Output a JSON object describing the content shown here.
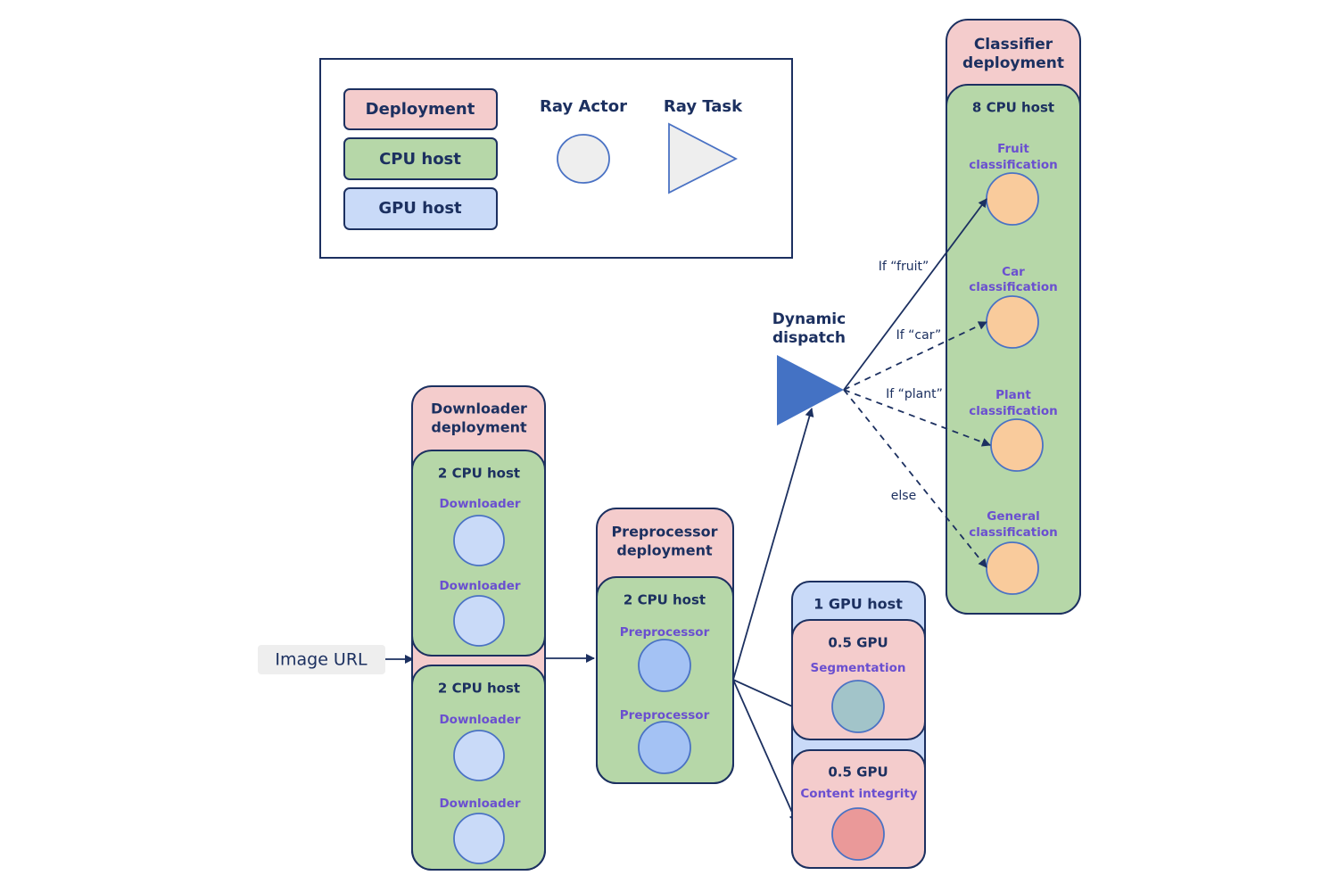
{
  "colors": {
    "deployment": "#f4cccc",
    "cpu_host": "#b6d7a8",
    "gpu_host": "#c9daf8",
    "outline": "#1c3060",
    "label": "#6a4fd0",
    "dispatch": "#4472c4"
  },
  "legend": {
    "deployment": "Deployment",
    "cpu_host": "CPU host",
    "gpu_host": "GPU host",
    "ray_actor": "Ray Actor",
    "ray_task": "Ray Task"
  },
  "input": {
    "label": "Image URL"
  },
  "downloader": {
    "title1": "Downloader",
    "title2": "deployment",
    "hosts": [
      {
        "label": "2 CPU host",
        "actors": [
          "Downloader",
          "Downloader"
        ]
      },
      {
        "label": "2 CPU host",
        "actors": [
          "Downloader",
          "Downloader"
        ]
      }
    ]
  },
  "preprocessor": {
    "title1": "Preprocessor",
    "title2": "deployment",
    "host": "2 CPU host",
    "actors": [
      "Preprocessor",
      "Preprocessor"
    ]
  },
  "gpu": {
    "host": "1 GPU host",
    "slots": [
      {
        "label": "0.5 GPU",
        "actor": "Segmentation"
      },
      {
        "label": "0.5 GPU",
        "actor": "Content integrity"
      }
    ]
  },
  "dispatch": {
    "title1": "Dynamic",
    "title2": "dispatch",
    "edges": [
      "If “fruit”",
      "If “car”",
      "If “plant”",
      "else"
    ]
  },
  "classifier": {
    "title1": "Classifier",
    "title2": "deployment",
    "host": "8 CPU host",
    "actors": [
      {
        "l1": "Fruit",
        "l2": "classification"
      },
      {
        "l1": "Car",
        "l2": "classification"
      },
      {
        "l1": "Plant",
        "l2": "classification"
      },
      {
        "l1": "General",
        "l2": "classification"
      }
    ]
  }
}
